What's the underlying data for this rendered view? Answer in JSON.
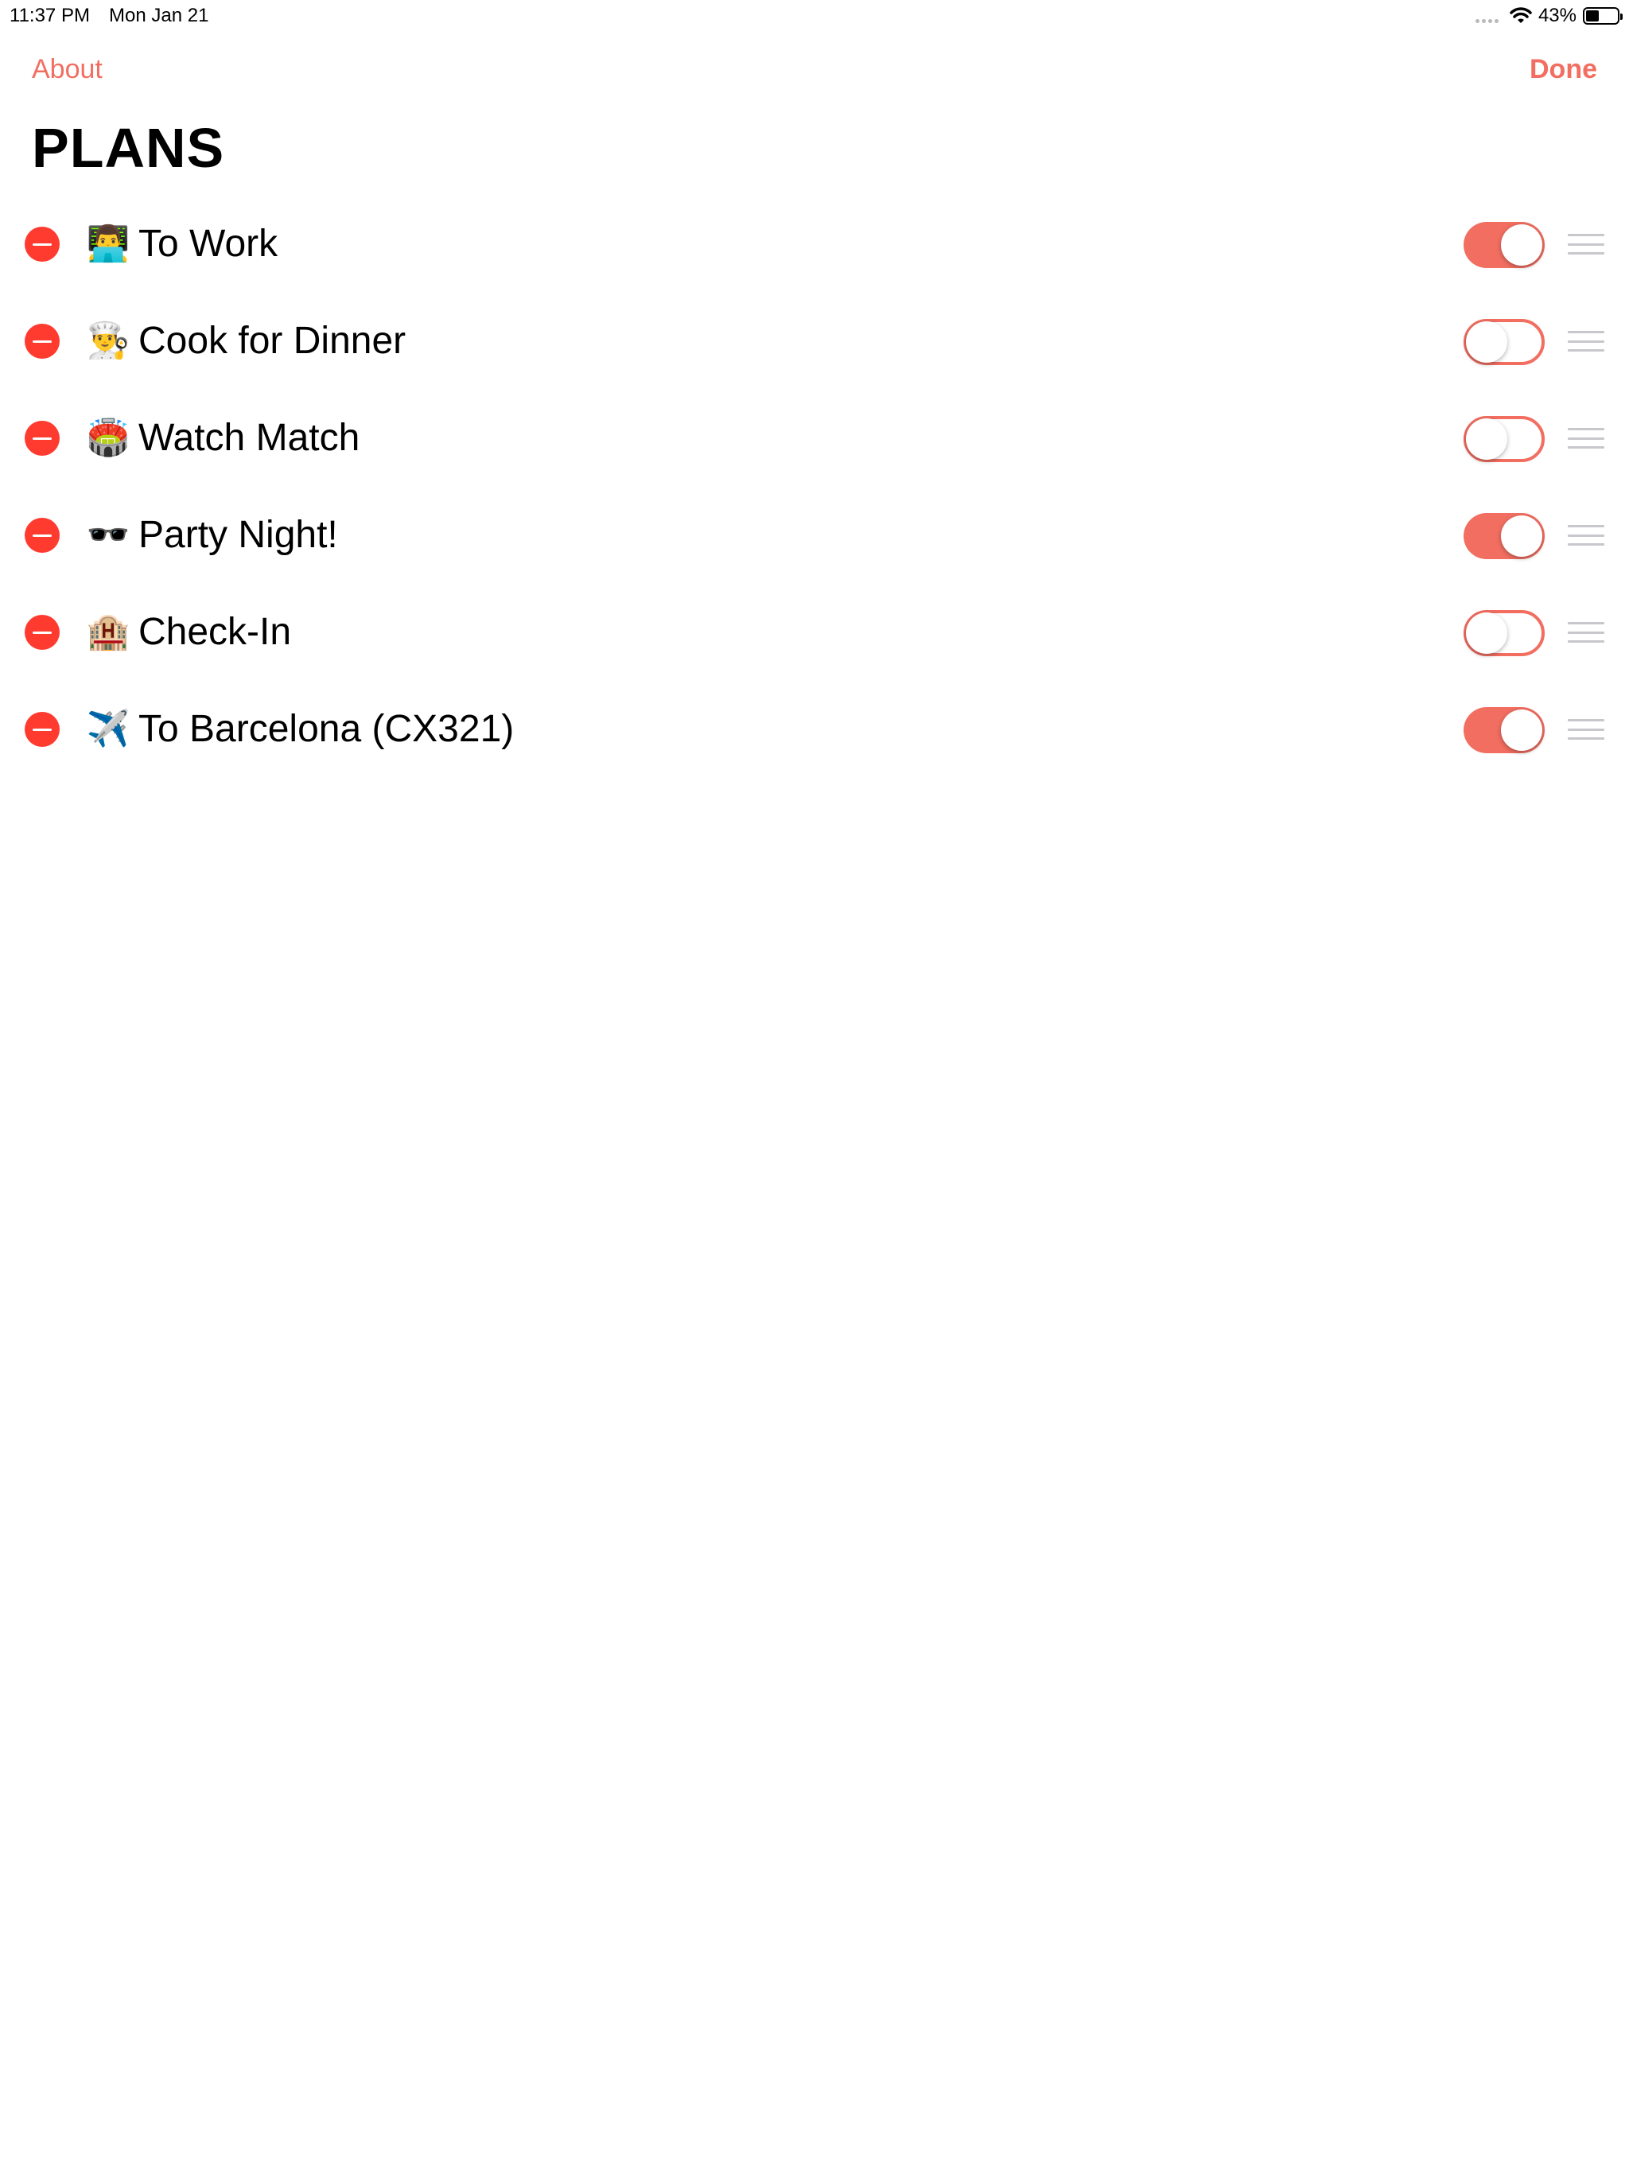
{
  "status_bar": {
    "time": "11:37 PM",
    "date": "Mon Jan 21",
    "battery": "43%",
    "battery_level": 0.43
  },
  "nav": {
    "left_label": "About",
    "right_label": "Done"
  },
  "title": "PLANS",
  "colors": {
    "accent": "#f16e61",
    "delete": "#ff3b30"
  },
  "plans": [
    {
      "emoji": "👨‍💻",
      "label": "To Work",
      "enabled": true
    },
    {
      "emoji": "👨‍🍳",
      "label": "Cook for Dinner",
      "enabled": false
    },
    {
      "emoji": "🏟️",
      "label": "Watch Match",
      "enabled": false
    },
    {
      "emoji": "🕶️",
      "label": "Party Night!",
      "enabled": true
    },
    {
      "emoji": "🏨",
      "label": "Check-In",
      "enabled": false
    },
    {
      "emoji": "✈️",
      "label": "To Barcelona (CX321)",
      "enabled": true
    }
  ]
}
